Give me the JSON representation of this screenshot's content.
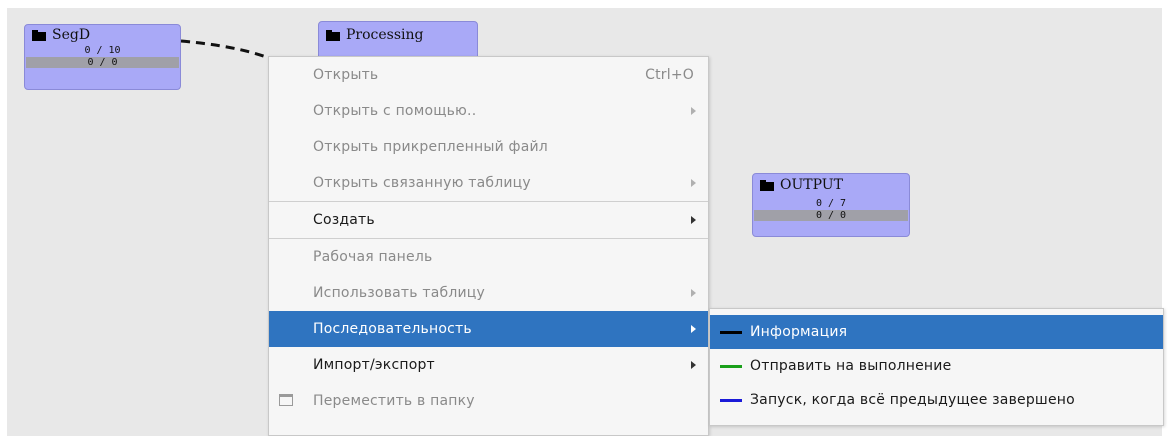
{
  "nodes": [
    {
      "name": "SegD",
      "count": "0 / 10",
      "bar": "0 / 0"
    },
    {
      "name": "Processing"
    },
    {
      "name": "OUTPUT",
      "count": "0 / 7",
      "bar": "0 / 0"
    }
  ],
  "context_menu": {
    "items": [
      {
        "label": "Открыть",
        "shortcut": "Ctrl+O"
      },
      {
        "label": "Открыть с помощью.."
      },
      {
        "label": "Открыть прикрепленный файл"
      },
      {
        "label": "Открыть связанную таблицу"
      },
      {
        "label": "Создать"
      },
      {
        "label": "Рабочая панель"
      },
      {
        "label": "Использовать таблицу"
      },
      {
        "label": "Последовательность"
      },
      {
        "label": "Импорт/экспорт"
      },
      {
        "label": "Переместить в папку"
      }
    ]
  },
  "submenu": {
    "items": [
      {
        "label": "Информация",
        "color": "#000000"
      },
      {
        "label": "Отправить на выполнение",
        "color": "#1aa01a"
      },
      {
        "label": "Запуск, когда всё предыдущее завершено",
        "color": "#1a1ad8"
      }
    ]
  },
  "colors": {
    "node_fill": "#a9a9f7",
    "highlight": "#2f74c0",
    "canvas": "#e8e8e8"
  }
}
